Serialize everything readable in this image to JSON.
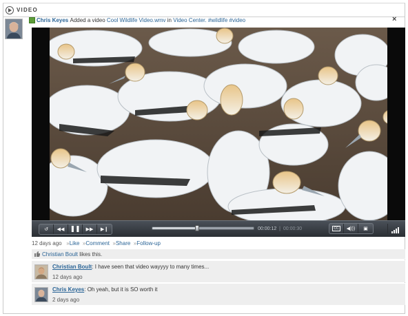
{
  "header": {
    "title": "VIDEO",
    "icon": "play-circle-icon"
  },
  "activity": {
    "author": "Chris Keyes",
    "action_text": "Added a video",
    "video_link": "Cool Wildlife Video.wmv",
    "in_text": "in",
    "location_link": "Video Center.",
    "tags": [
      "#wildlife",
      "#video"
    ],
    "close_label": "×"
  },
  "player": {
    "current_time": "00:00:12",
    "separator": "|",
    "total_time": "00:00:30",
    "progress": 0.44,
    "buttons": [
      "replay",
      "rewind",
      "pause",
      "fast-forward",
      "skip-forward"
    ],
    "right_buttons": [
      "cc",
      "volume",
      "fullscreen"
    ],
    "cc_label": "CC"
  },
  "meta": {
    "time": "12 days ago",
    "actions": [
      "Like",
      "Comment",
      "Share",
      "Follow-up"
    ],
    "action_prefix": "»"
  },
  "likes": {
    "name": "Christian Boult",
    "text": "likes this."
  },
  "comments": [
    {
      "author": "Christian Boult",
      "text": ": I have seen that video wayyyy to many times...",
      "time": "12 days ago"
    },
    {
      "author": "Chris Keyes",
      "text": ": Oh yeah, but it is SO worth it",
      "time": "2 days ago"
    }
  ],
  "colors": {
    "link": "#2a6496",
    "panel": "#eeeeee",
    "player_bar": "#2a2e33"
  }
}
